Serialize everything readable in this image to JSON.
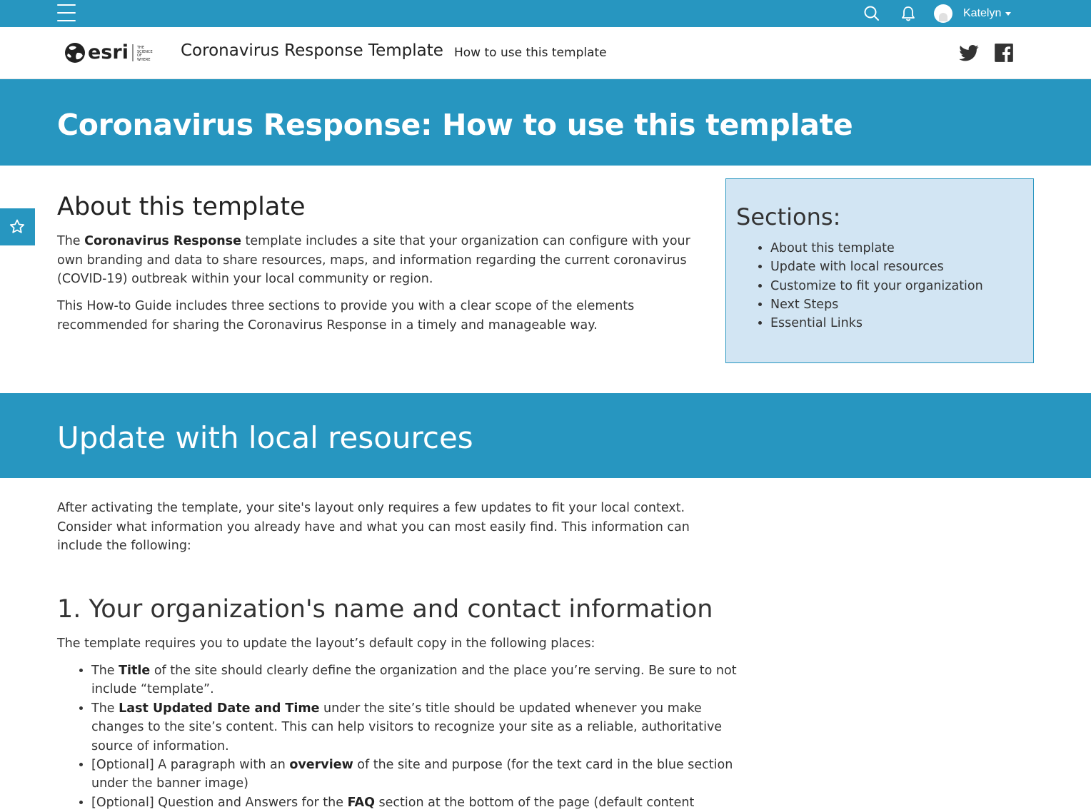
{
  "topbar": {
    "user_name": "Katelyn",
    "icons": [
      "menu-icon",
      "search-icon",
      "bell-icon",
      "avatar",
      "chevron-down-icon"
    ]
  },
  "header": {
    "logo_text": "esri",
    "logo_tagline": "THE SCIENCE OF WHERE",
    "site_title": "Coronavirus Response Template",
    "nav_link": "How to use this template",
    "social_icons": [
      "twitter-icon",
      "facebook-icon"
    ]
  },
  "hero": {
    "title": "Coronavirus Response: How to use this template"
  },
  "about": {
    "heading": "About this template",
    "p1_prefix": "The ",
    "p1_bold": "Coronavirus Response",
    "p1_suffix": " template includes a site that your organization can configure with your own branding and data to share resources, maps, and information regarding the current coronavirus (COVID-19) outbreak within your local community or region.",
    "p2": "This How-to Guide includes three sections to provide you with a clear scope of the elements recommended for sharing the Coronavirus Response in a timely and manageable way."
  },
  "sections_box": {
    "heading": "Sections:",
    "items": [
      "About this template",
      "Update with local resources",
      "Customize to fit your organization",
      "Next Steps",
      "Essential Links"
    ]
  },
  "update": {
    "heading": "Update with local resources",
    "intro": "After activating the template, your site's layout only requires a few updates to fit your local context. Consider what information you already have and what you can most easily find. This information can include the following:"
  },
  "org_info": {
    "heading": "1. Your organization's name and contact information",
    "intro": "The template requires you to update the layout’s default copy in the following places:",
    "bullets": [
      {
        "pre": "The ",
        "bold": "Title",
        "post": " of the site should clearly define the organization and the place you’re serving. Be sure to not include “template”."
      },
      {
        "pre": "The ",
        "bold": "Last Updated Date and Time",
        "post": " under the site’s title should be updated whenever you make changes to the site’s content. This can help visitors to recognize your site as a reliable, authoritative source of information."
      },
      {
        "pre": "[Optional] A paragraph with an ",
        "bold": "overview",
        "post": " of the site and purpose (for the text card in the blue section under the banner image)"
      },
      {
        "pre": "[Optional] Question and Answers for the ",
        "bold": "FAQ",
        "post": " section at the bottom of the page (default content"
      }
    ]
  },
  "colors": {
    "brand_blue": "#2796c0",
    "sections_bg": "#d2e5f3",
    "text": "#333333"
  }
}
